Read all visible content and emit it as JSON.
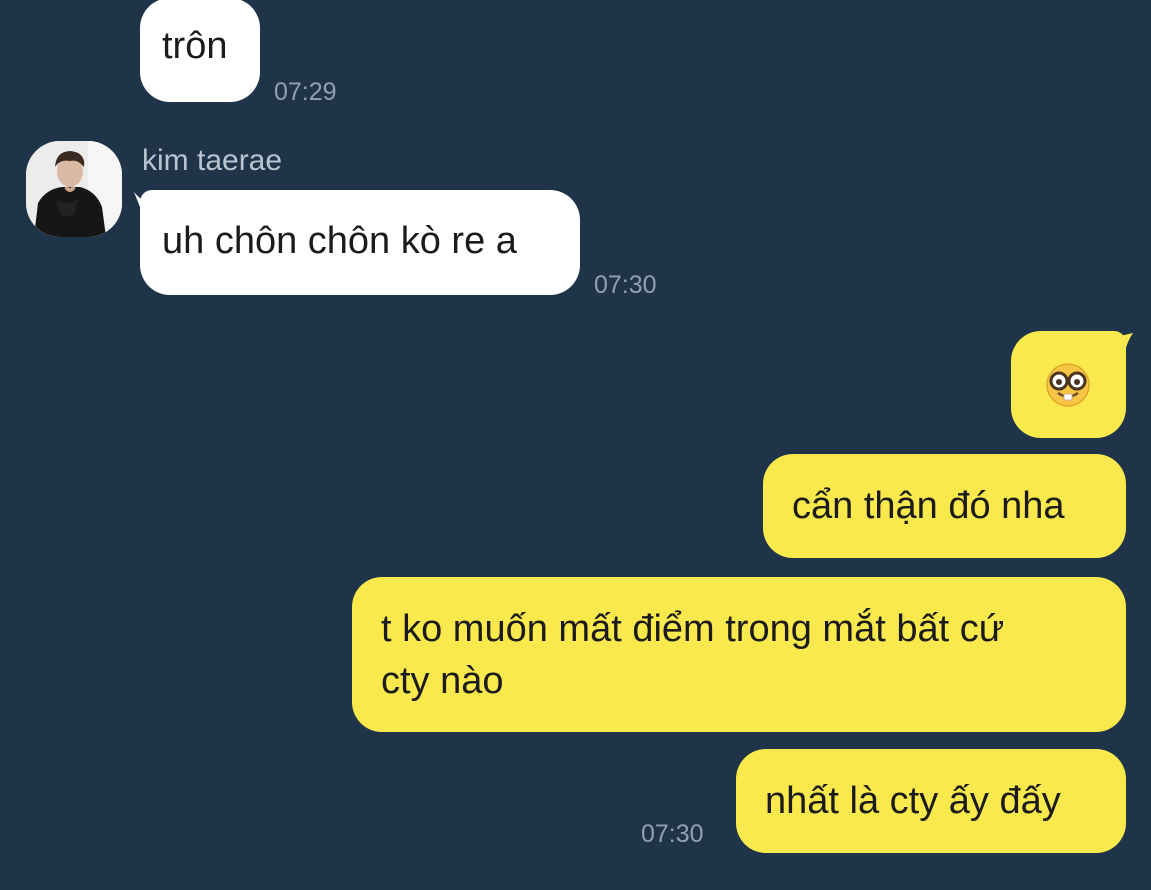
{
  "colors": {
    "background": "#1f3448",
    "incoming_bubble": "#ffffff",
    "outgoing_bubble": "#fae94c",
    "timestamp": "#8fa0b1",
    "sender_name": "#b8c4d0"
  },
  "messages": [
    {
      "direction": "incoming",
      "text": "trôn",
      "time": "07:29"
    },
    {
      "direction": "incoming",
      "sender": "kim taerae",
      "text": "uh chôn chôn kò re a",
      "time": "07:30",
      "avatar_icon": "profile-photo"
    },
    {
      "direction": "outgoing",
      "emoji_icon": "nerd-face-emoji"
    },
    {
      "direction": "outgoing",
      "text": "cẩn thận đó nha"
    },
    {
      "direction": "outgoing",
      "text_line1": "t ko muốn mất điểm trong mắt bất cứ",
      "text_line2": "cty nào"
    },
    {
      "direction": "outgoing",
      "text": "nhất là cty ấy đấy",
      "time": "07:30"
    }
  ]
}
